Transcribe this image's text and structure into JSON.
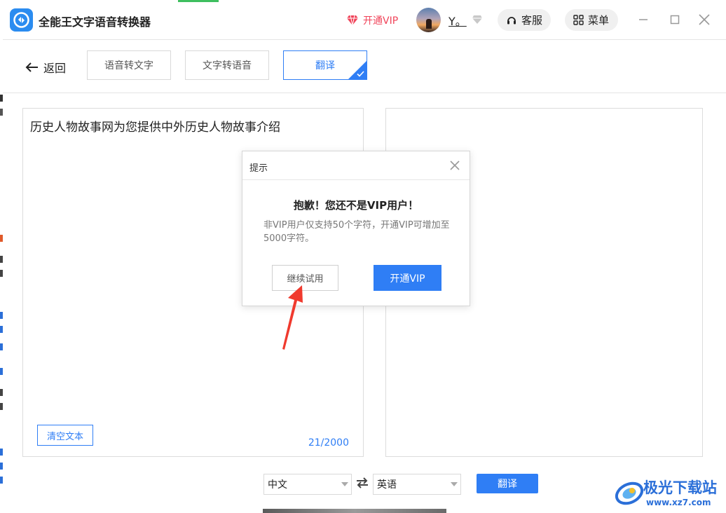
{
  "app": {
    "title": "全能王文字语音转换器",
    "vip_link": "开通VIP",
    "username": "Y。",
    "service_label": "客服",
    "menu_label": "菜单"
  },
  "nav": {
    "back_label": "返回",
    "tabs": [
      {
        "label": "语音转文字",
        "selected": false
      },
      {
        "label": "文字转语音",
        "selected": false
      },
      {
        "label": "翻译",
        "selected": true
      }
    ]
  },
  "source_panel": {
    "text": "历史人物故事网为您提供中外历史人物故事介绍",
    "clear_label": "清空文本",
    "char_count": "21/2000"
  },
  "target_panel": {
    "text": ""
  },
  "language_bar": {
    "from_language": "中文",
    "to_language": "英语",
    "translate_label": "翻译"
  },
  "dialog": {
    "title": "提示",
    "heading": "抱歉！您还不是VIP用户！",
    "message": "非VIP用户仅支持50个字符，开通VIP可增加至5000字符。",
    "trial_label": "继续试用",
    "vip_label": "开通VIP"
  },
  "watermark": {
    "brand": "极光下载站",
    "url": "www.xz7.com"
  },
  "colors": {
    "accent": "#2f7ef5",
    "vip_red": "#f0445a",
    "annotation_arrow": "#f03a2e"
  }
}
